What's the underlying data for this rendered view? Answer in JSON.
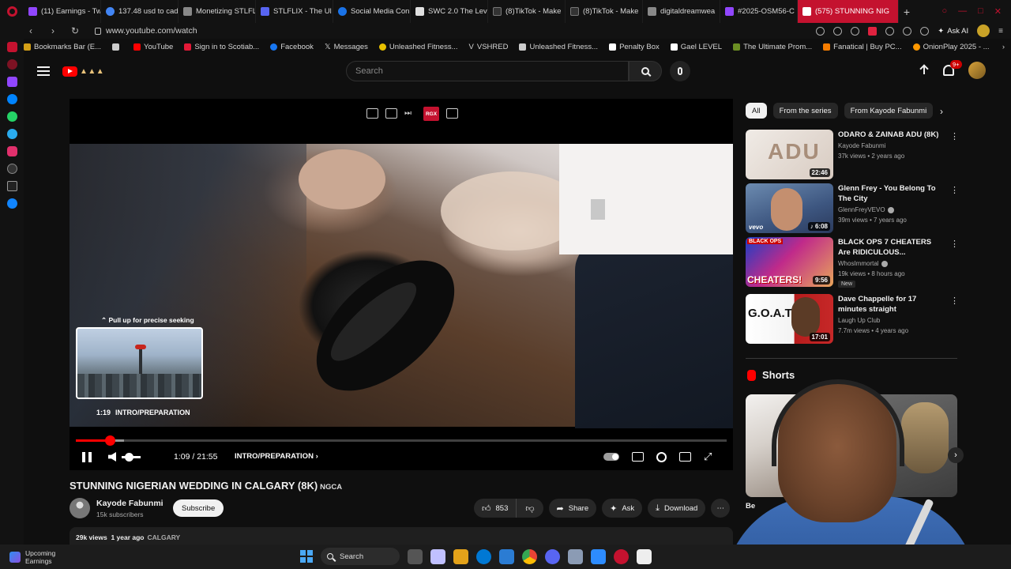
{
  "browser": {
    "tabs": [
      {
        "label": "(11) Earnings - Tw",
        "color": "#9146ff"
      },
      {
        "label": "137.48 usd to cad",
        "color": "#4285f4"
      },
      {
        "label": "Monetizing STLFL",
        "color": "#888888"
      },
      {
        "label": "STLFLIX - The Ul",
        "color": "#5865f2"
      },
      {
        "label": "Social Media Con",
        "color": "#1a73e8"
      },
      {
        "label": "SWC 2.0 The Lev",
        "color": "#e0e0e0"
      },
      {
        "label": "(8)TikTok - Make",
        "color": "#000000"
      },
      {
        "label": "(8)TikTok - Make",
        "color": "#000000"
      },
      {
        "label": "digitaldreamwea",
        "color": "#888888"
      },
      {
        "label": "#2025-OSM56-C",
        "color": "#9146ff"
      }
    ],
    "active_tab": {
      "label": "(575) STUNNING NIG",
      "color": "#ffffff"
    },
    "url": "www.youtube.com/watch",
    "ask_ai": "Ask AI",
    "bookmarks": [
      {
        "label": "Bookmarks Bar (E...",
        "color": "#d4a017"
      },
      {
        "label": "",
        "color": "#cccccc"
      },
      {
        "label": "YouTube",
        "color": "#ff0000"
      },
      {
        "label": "Sign in to Scotiab...",
        "color": "#e31937"
      },
      {
        "label": "Facebook",
        "color": "#1877f2"
      },
      {
        "label": "Messages",
        "color": "#ffffff"
      },
      {
        "label": "Unleashed Fitness...",
        "color": "#e8c100"
      },
      {
        "label": "VSHRED",
        "color": "#cccccc"
      },
      {
        "label": "Unleashed Fitness...",
        "color": "#cccccc"
      },
      {
        "label": "Penalty Box",
        "color": "#ffffff"
      },
      {
        "label": "Gael LEVEL",
        "color": "#ffffff"
      },
      {
        "label": "The Ultimate Prom...",
        "color": "#6b8e23"
      },
      {
        "label": "Fanatical | Buy PC...",
        "color": "#f57c00"
      },
      {
        "label": "OnionPlay 2025 - ...",
        "color": "#ff9800"
      }
    ]
  },
  "youtube": {
    "search_placeholder": "Search",
    "notif_count": "9+",
    "player": {
      "seek_hint": "⌃ Pull up for precise seeking",
      "preview_time": "1:19",
      "preview_chapter": "INTRO/PREPARATION",
      "rgx_label": "RGX",
      "current_time": "1:09 / 21:55",
      "chapter": "INTRO/PREPARATION",
      "progress_played": 0.052,
      "progress_buffered": 0.074
    },
    "video": {
      "title": "STUNNING NIGERIAN WEDDING IN CALGARY (8K)",
      "title_tag": "NGCA",
      "channel": "Kayode Fabunmi",
      "subscribers": "15k subscribers",
      "subscribe_label": "Subscribe",
      "likes": "853",
      "share_label": "Share",
      "ask_label": "Ask",
      "download_label": "Download",
      "views": "29k views",
      "age": "1 year ago",
      "location_tag": "CALGARY"
    },
    "chips": [
      "All",
      "From the series",
      "From Kayode Fabunmi"
    ],
    "recommendations": [
      {
        "title": "ODARO & ZAINAB ADU (8K)",
        "channel": "Kayode Fabunmi",
        "meta": "37k views • 2 years ago",
        "duration": "22:46",
        "thumb_text": "ADU",
        "verified": false,
        "new": false
      },
      {
        "title": "Glenn Frey - You Belong To The City",
        "channel": "GlennFreyVEVO",
        "meta": "39m views • 7 years ago",
        "duration": "6:08",
        "thumb_text": "vevo",
        "verified": true,
        "new": false
      },
      {
        "title": "BLACK OPS 7 CHEATERS Are RIDICULOUS...",
        "channel": "WhosImmortal",
        "meta": "19k views • 8 hours ago",
        "duration": "9:56",
        "thumb_text": "CHEATERS!",
        "thumb_top": "BLACK OPS",
        "verified": true,
        "new": true,
        "new_label": "New"
      },
      {
        "title": "Dave Chappelle for 17 minutes straight",
        "channel": "Laugh Up Club",
        "meta": "7.7m views • 4 years ago",
        "duration": "17:01",
        "thumb_text": "G.O.A.T",
        "verified": false,
        "new": false
      }
    ],
    "shorts_label": "Shorts",
    "short_title": "Be"
  },
  "taskbar": {
    "upcoming_line1": "Upcoming",
    "upcoming_line2": "Earnings",
    "search_label": "Search",
    "apps": [
      "#e3a21a",
      "#0078d4",
      "#f25022",
      "#34a853",
      "#ffffff",
      "#5865f2",
      "#2d8cff",
      "#8b9bb4",
      "#d81b60",
      "#cccccc"
    ]
  }
}
